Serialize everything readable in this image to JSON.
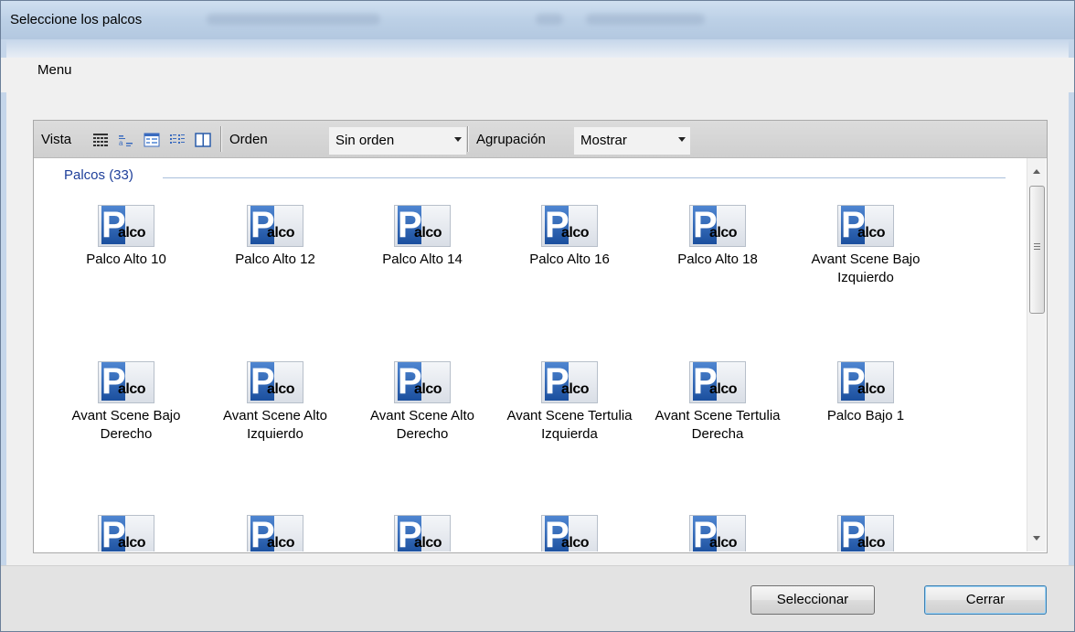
{
  "window": {
    "title": "Seleccione los palcos"
  },
  "menu": {
    "items": [
      "Menu"
    ]
  },
  "toolbar": {
    "vista_label": "Vista",
    "orden_label": "Orden",
    "orden_value": "Sin orden",
    "agrupacion_label": "Agrupación",
    "agrupacion_value": "Mostrar",
    "view_icons": [
      "large-icons-view-icon",
      "tiles-view-icon",
      "details-view-icon",
      "list-view-icon",
      "columns-view-icon"
    ]
  },
  "group": {
    "header": "Palcos (33)"
  },
  "items": [
    {
      "label": "Palco Alto 10"
    },
    {
      "label": "Palco Alto 12"
    },
    {
      "label": "Palco Alto 14"
    },
    {
      "label": "Palco Alto 16"
    },
    {
      "label": "Palco Alto 18"
    },
    {
      "label": "Avant Scene Bajo Izquierdo"
    },
    {
      "label": "Avant Scene Bajo Derecho"
    },
    {
      "label": "Avant Scene Alto Izquierdo"
    },
    {
      "label": "Avant Scene Alto Derecho"
    },
    {
      "label": "Avant Scene Tertulia Izquierda"
    },
    {
      "label": "Avant Scene Tertulia Derecha"
    },
    {
      "label": "Palco Bajo 1"
    }
  ],
  "icon_text": {
    "p": "P",
    "alco": "alco"
  },
  "buttons": {
    "select": "Seleccionar",
    "close": "Cerrar"
  },
  "colors": {
    "group_header": "#1e3f9a",
    "titlebar": "#bcd0e6"
  }
}
